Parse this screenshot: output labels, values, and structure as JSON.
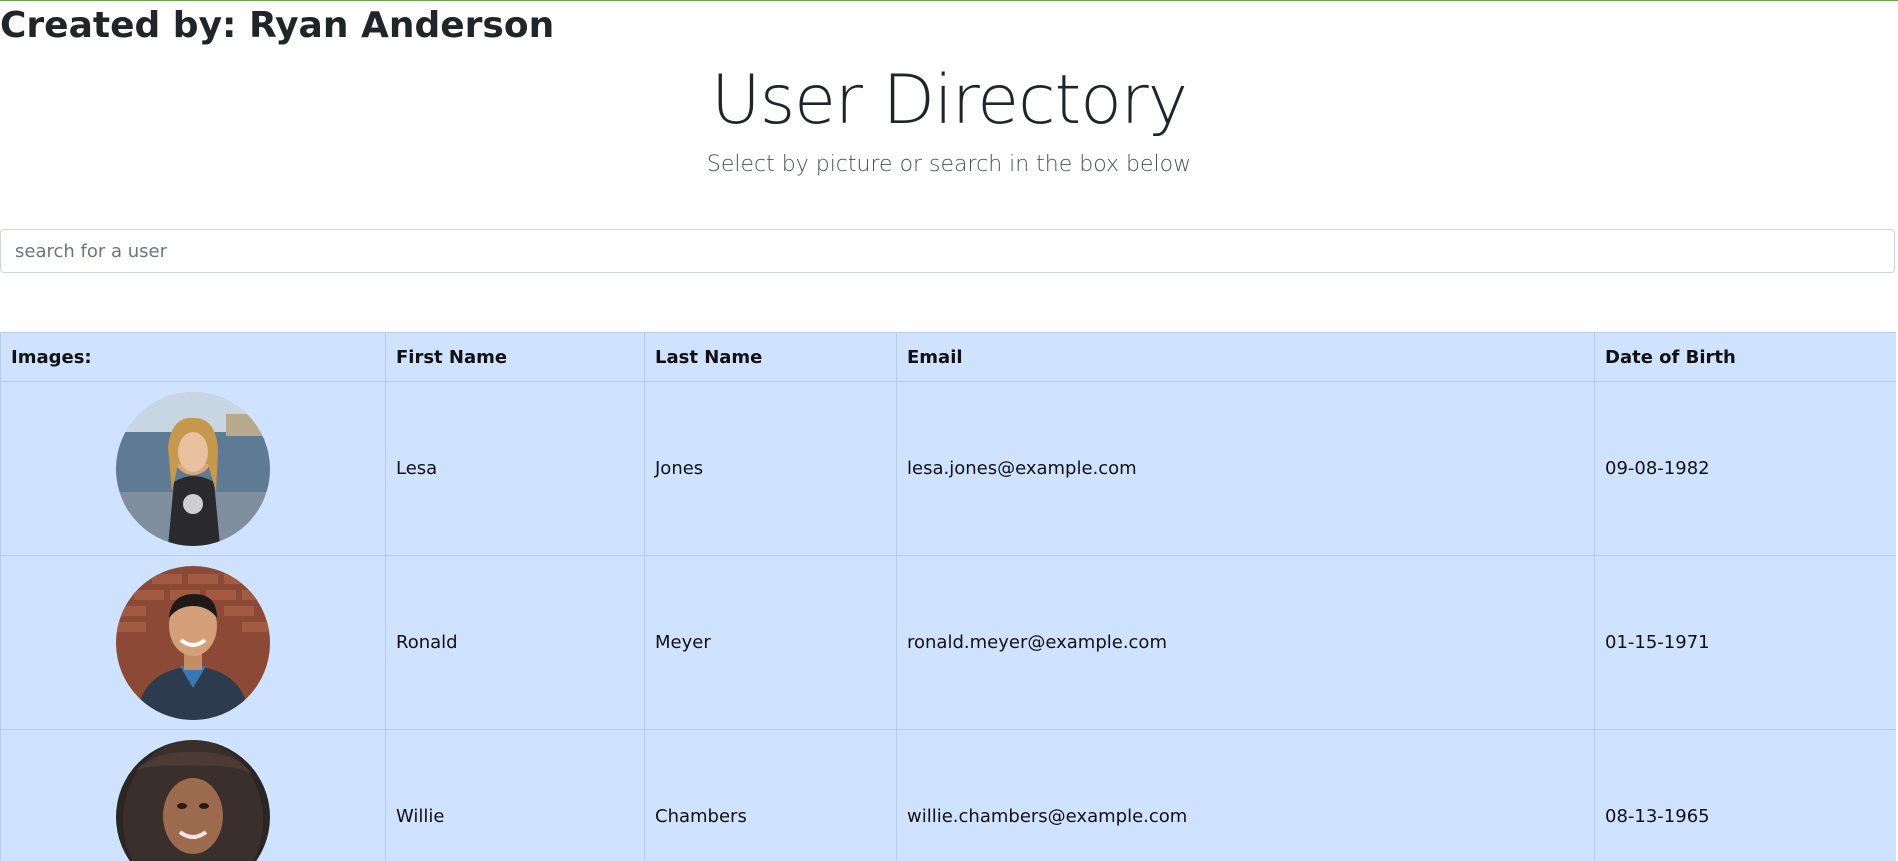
{
  "header": {
    "creator": "Created by: Ryan Anderson",
    "title": "User Directory",
    "subtitle": "Select by picture or search in the box below"
  },
  "search": {
    "placeholder": "search for a user",
    "value": ""
  },
  "table": {
    "columns": [
      "Images:",
      "First Name",
      "Last Name",
      "Email",
      "Date of Birth"
    ],
    "rows": [
      {
        "first": "Lesa",
        "last": "Jones",
        "email": "lesa.jones@example.com",
        "dob": "09-08-1982"
      },
      {
        "first": "Ronald",
        "last": "Meyer",
        "email": "ronald.meyer@example.com",
        "dob": "01-15-1971"
      },
      {
        "first": "Willie",
        "last": "Chambers",
        "email": "willie.chambers@example.com",
        "dob": "08-13-1965"
      }
    ]
  },
  "colors": {
    "table_bg": "#cfe2ff",
    "accent_line": "#6aa84f"
  }
}
